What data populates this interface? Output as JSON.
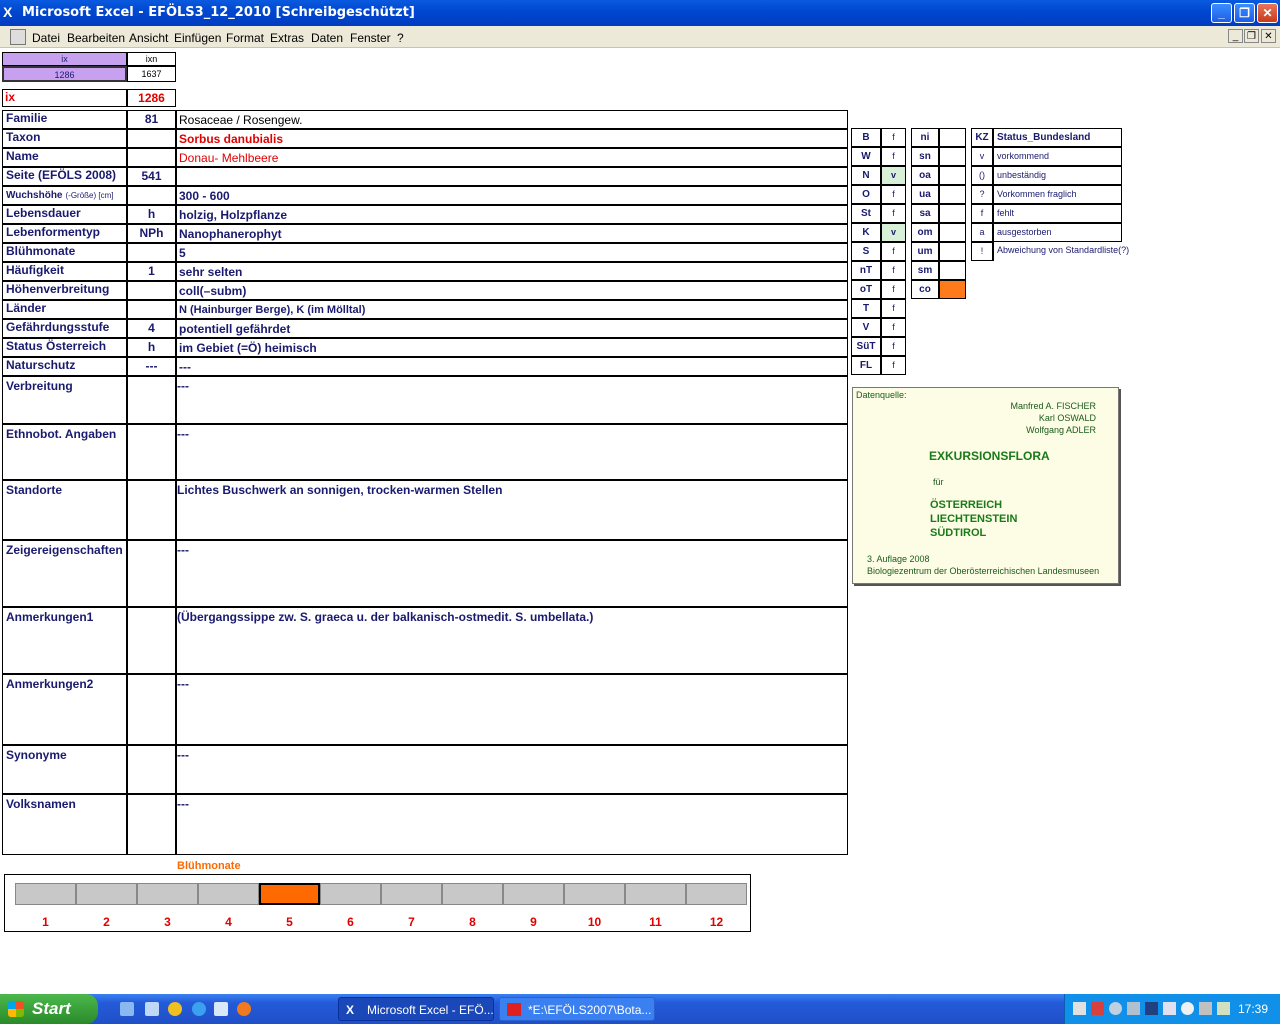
{
  "window": {
    "title": "Microsoft Excel - EFÖLS3_12_2010  [Schreibgeschützt]"
  },
  "menu": [
    "Datei",
    "Bearbeiten",
    "Ansicht",
    "Einfügen",
    "Format",
    "Extras",
    "Daten",
    "Fenster",
    "?"
  ],
  "top_cells": {
    "ix_head": "ix",
    "ixn_head": "ixn",
    "ix_val": "1286",
    "ixn_val": "1637",
    "ix_label": "ix",
    "ix_big": "1286"
  },
  "rows": [
    {
      "label": "Familie",
      "code": "81",
      "text": "Rosaceae  /  Rosengew."
    },
    {
      "label": "Taxon",
      "code": "",
      "text": "Sorbus danubialis"
    },
    {
      "label": "Name",
      "code": "",
      "text": "Donau- Mehlbeere"
    },
    {
      "label": "Seite (EFÖLS 2008)",
      "code": "541",
      "text": ""
    },
    {
      "label": "Wuchshöhe",
      "label_suffix": "(-Größe) [cm]",
      "code": "",
      "text": "300 - 600"
    },
    {
      "label": "Lebensdauer",
      "code": "h",
      "text": "holzig, Holzpflanze"
    },
    {
      "label": "Lebenformentyp",
      "code": "NPh",
      "text": "Nanophanerophyt"
    },
    {
      "label": "Blühmonate",
      "code": "",
      "text": "5"
    },
    {
      "label": "Häufigkeit",
      "code": "1",
      "text": "sehr selten"
    },
    {
      "label": "Höhenverbreitung",
      "code": "",
      "text": "coll(–subm)"
    },
    {
      "label": "Länder",
      "code": "",
      "text": "N (Hainburger Berge), K (im Mölltal)"
    },
    {
      "label": "Gefährdungsstufe",
      "code": "4",
      "text": "potentiell gefährdet"
    },
    {
      "label": "Status Österreich",
      "code": "h",
      "text": "im Gebiet (=Ö) heimisch"
    },
    {
      "label": "Naturschutz",
      "code": "---",
      "text": "---"
    }
  ],
  "big_rows": [
    {
      "label": "Verbreitung",
      "text": "---"
    },
    {
      "label": "Ethnobot. Angaben",
      "text": "---"
    },
    {
      "label": "Standorte",
      "text": "Lichtes Buschwerk an sonnigen, trocken-warmen Stellen"
    },
    {
      "label": "Zeigereigenschaften",
      "text": "---"
    },
    {
      "label": "Anmerkungen1",
      "text": "(Übergangssippe zw. S. graeca u. der balkanisch-ostmedit. S. umbellata.)"
    },
    {
      "label": "Anmerkungen2",
      "text": "---"
    },
    {
      "label": "Synonyme",
      "text": "---"
    },
    {
      "label": "Volksnamen",
      "text": "---"
    }
  ],
  "states": [
    {
      "code": "B",
      "val": "f",
      "green": false
    },
    {
      "code": "W",
      "val": "f",
      "green": false
    },
    {
      "code": "N",
      "val": "v",
      "green": true
    },
    {
      "code": "O",
      "val": "f",
      "green": false
    },
    {
      "code": "St",
      "val": "f",
      "green": false
    },
    {
      "code": "K",
      "val": "v",
      "green": true
    },
    {
      "code": "S",
      "val": "f",
      "green": false
    },
    {
      "code": "nT",
      "val": "f",
      "green": false
    },
    {
      "code": "oT",
      "val": "f",
      "green": false
    },
    {
      "code": "T",
      "val": "f",
      "green": false
    },
    {
      "code": "V",
      "val": "f",
      "green": false
    },
    {
      "code": "SüT",
      "val": "f",
      "green": false
    },
    {
      "code": "FL",
      "val": "f",
      "green": false
    }
  ],
  "altitude": [
    {
      "code": "ni",
      "on": false
    },
    {
      "code": "sn",
      "on": false
    },
    {
      "code": "oa",
      "on": false
    },
    {
      "code": "ua",
      "on": false
    },
    {
      "code": "sa",
      "on": false
    },
    {
      "code": "om",
      "on": false
    },
    {
      "code": "um",
      "on": false
    },
    {
      "code": "sm",
      "on": false
    },
    {
      "code": "co",
      "on": true
    }
  ],
  "legend": {
    "kz_head": "KZ",
    "status_head": "Status_Bundesland",
    "items": [
      {
        "kz": "v",
        "text": "vorkommend"
      },
      {
        "kz": "()",
        "text": "unbeständig"
      },
      {
        "kz": "?",
        "text": "Vorkommen fraglich"
      },
      {
        "kz": "f",
        "text": "fehlt"
      },
      {
        "kz": "a",
        "text": "ausgestorben"
      },
      {
        "kz": "!",
        "text": "Abweichung von Standardliste(?)"
      }
    ]
  },
  "source": {
    "label": "Datenquelle:",
    "authors": [
      "Manfred A. FISCHER",
      "Karl OSWALD",
      "Wolfgang ADLER"
    ],
    "title": "EXKURSIONSFLORA",
    "fuer": "für",
    "countries": [
      "ÖSTERREICH",
      "LIECHTENSTEIN",
      "SÜDTIROL"
    ],
    "edition": "3. Auflage 2008",
    "publisher": "Biologiezentrum der Oberösterreichischen Landesmuseen"
  },
  "bloom": {
    "title": "Blühmonate",
    "months": [
      "1",
      "2",
      "3",
      "4",
      "5",
      "6",
      "7",
      "8",
      "9",
      "10",
      "11",
      "12"
    ],
    "active_month": 5,
    "active_color": "#ff6a00"
  },
  "taskbar": {
    "start": "Start",
    "tasks": [
      "Microsoft Excel - EFÖ...",
      "*E:\\EFÖLS2007\\Bota..."
    ],
    "clock": "17:39"
  }
}
